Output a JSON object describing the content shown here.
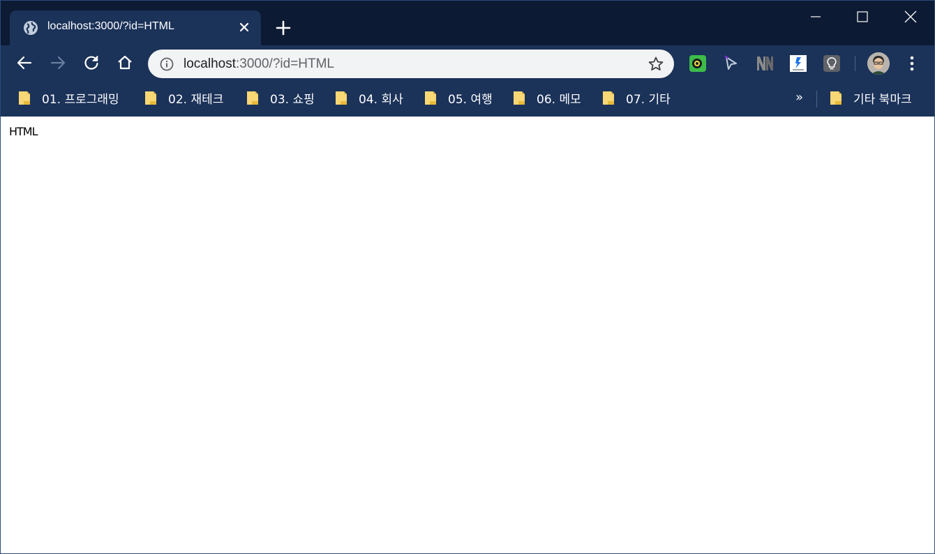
{
  "tab": {
    "title": "localhost:3000/?id=HTML"
  },
  "omnibox": {
    "host": "localhost",
    "path": ":3000/?id=HTML"
  },
  "bookmarks": [
    {
      "label": "01. 프로그래밍"
    },
    {
      "label": "02. 재테크"
    },
    {
      "label": "03. 쇼핑"
    },
    {
      "label": "04. 회사"
    },
    {
      "label": "05. 여행"
    },
    {
      "label": "06. 메모"
    },
    {
      "label": "07. 기타"
    }
  ],
  "bookmarks_more": "»",
  "other_bookmarks": {
    "label": "기타 북마크"
  },
  "page": {
    "body_text": "HTML"
  },
  "colors": {
    "titlebar": "#0c1a33",
    "toolbar": "#1b3259",
    "omnibox": "#f1f3f4",
    "folder": "#f8d775"
  }
}
